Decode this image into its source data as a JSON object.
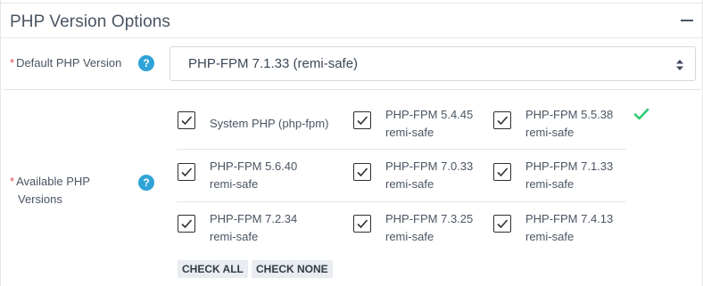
{
  "panel": {
    "title": "PHP Version Options",
    "collapse_icon": "minus-icon"
  },
  "default_version": {
    "required_mark": "*",
    "label": "Default PHP Version",
    "help_glyph": "?",
    "selected": "PHP-FPM 7.1.33 (remi-safe)",
    "arrows_icon": "sort-arrows-icon"
  },
  "available": {
    "required_mark": "*",
    "label_line1": "Available PHP",
    "label_line2": "Versions",
    "help_glyph": "?",
    "options": [
      {
        "name": "System PHP (php-fpm)",
        "sub": "",
        "checked": true
      },
      {
        "name": "PHP-FPM 5.4.45",
        "sub": "remi-safe",
        "checked": true
      },
      {
        "name": "PHP-FPM 5.5.38",
        "sub": "remi-safe",
        "checked": true
      },
      {
        "name": "PHP-FPM 5.6.40",
        "sub": "remi-safe",
        "checked": true
      },
      {
        "name": "PHP-FPM 7.0.33",
        "sub": "remi-safe",
        "checked": true
      },
      {
        "name": "PHP-FPM 7.1.33",
        "sub": "remi-safe",
        "checked": true
      },
      {
        "name": "PHP-FPM 7.2.34",
        "sub": "remi-safe",
        "checked": true
      },
      {
        "name": "PHP-FPM 7.3.25",
        "sub": "remi-safe",
        "checked": true
      },
      {
        "name": "PHP-FPM 7.4.13",
        "sub": "remi-safe",
        "checked": true
      }
    ],
    "status_icon": "checkmark-icon",
    "status_color": "#2ecc71",
    "check_all": "CHECK ALL",
    "check_none": "CHECK NONE"
  }
}
